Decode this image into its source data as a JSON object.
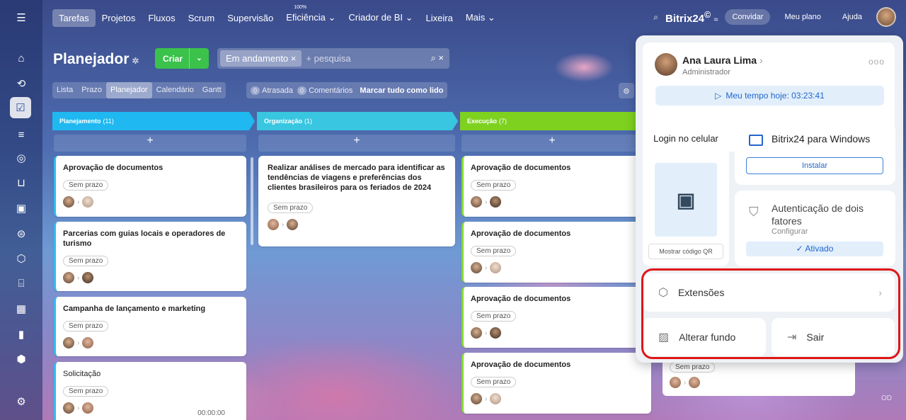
{
  "nav": {
    "tabs": [
      {
        "label": "Tarefas",
        "active": true
      },
      {
        "label": "Projetos"
      },
      {
        "label": "Fluxos"
      },
      {
        "label": "Scrum"
      },
      {
        "label": "Supervisão"
      },
      {
        "label": "Eficiência ⌄",
        "sup": "100%"
      },
      {
        "label": "Criador de BI ⌄"
      },
      {
        "label": "Lixeira"
      },
      {
        "label": "Mais ⌄"
      }
    ],
    "brand": "Bitrix24",
    "brand_mark": "©",
    "invite": "Convidar",
    "plan": "Meu plano",
    "help": "Ajuda"
  },
  "page": {
    "title": "Planejador",
    "create": "Criar",
    "filter_chip": "Em andamento",
    "search_placeholder": "+ pesquisa"
  },
  "views": [
    "Lista",
    "Prazo",
    "Planejador",
    "Calendário",
    "Gantt"
  ],
  "counters": {
    "overdue_count": "0",
    "overdue": "Atrasada",
    "comments_count": "0",
    "comments": "Comentários",
    "mark_all": "Marcar tudo como lido"
  },
  "columns": [
    {
      "name": "Planejamento",
      "count": "(11)",
      "color": "#1fb8f0"
    },
    {
      "name": "Organização",
      "count": "(1)",
      "color": "#39c6e0"
    },
    {
      "name": "Execução",
      "count": "(7)",
      "color": "#7ed21f"
    }
  ],
  "cards": {
    "col1": [
      {
        "title": "Aprovação de documentos",
        "deadline": "Sem prazo"
      },
      {
        "title": "Parcerias com guias locais e operadores de turismo",
        "deadline": "Sem prazo"
      },
      {
        "title": "Campanha de lançamento e marketing",
        "deadline": "Sem prazo"
      },
      {
        "title": "Solicitação",
        "deadline": "Sem prazo",
        "timer": "00:00:00"
      }
    ],
    "col2": [
      {
        "title": "Realizar análises de mercado para identificar as tendências de viagens e preferências dos clientes brasileiros para os feriados de 2024",
        "deadline": "Sem prazo"
      }
    ],
    "col3": [
      {
        "title": "Aprovação de documentos",
        "deadline": "Sem prazo"
      },
      {
        "title": "Aprovação de documentos",
        "deadline": "Sem prazo"
      },
      {
        "title": "Aprovação de documentos",
        "deadline": "Sem prazo"
      },
      {
        "title": "Aprovação de documentos",
        "deadline": "Sem prazo"
      }
    ],
    "col4_partial": {
      "deadline": "Sem prazo"
    }
  },
  "panel": {
    "user_name": "Ana Laura Lima",
    "role": "Administrador",
    "time_today": "Meu tempo hoje: 03:23:41",
    "login_title": "Login no celular",
    "show_qr": "Mostrar código QR",
    "windows_title": "Bitrix24 para Windows",
    "install": "Instalar",
    "twofa_title": "Autenticação de dois fatores",
    "twofa_config": "Configurar",
    "twofa_status": "✓ Ativado",
    "extensions": "Extensões",
    "change_bg": "Alterar fundo",
    "logout": "Sair"
  },
  "od": "OD"
}
